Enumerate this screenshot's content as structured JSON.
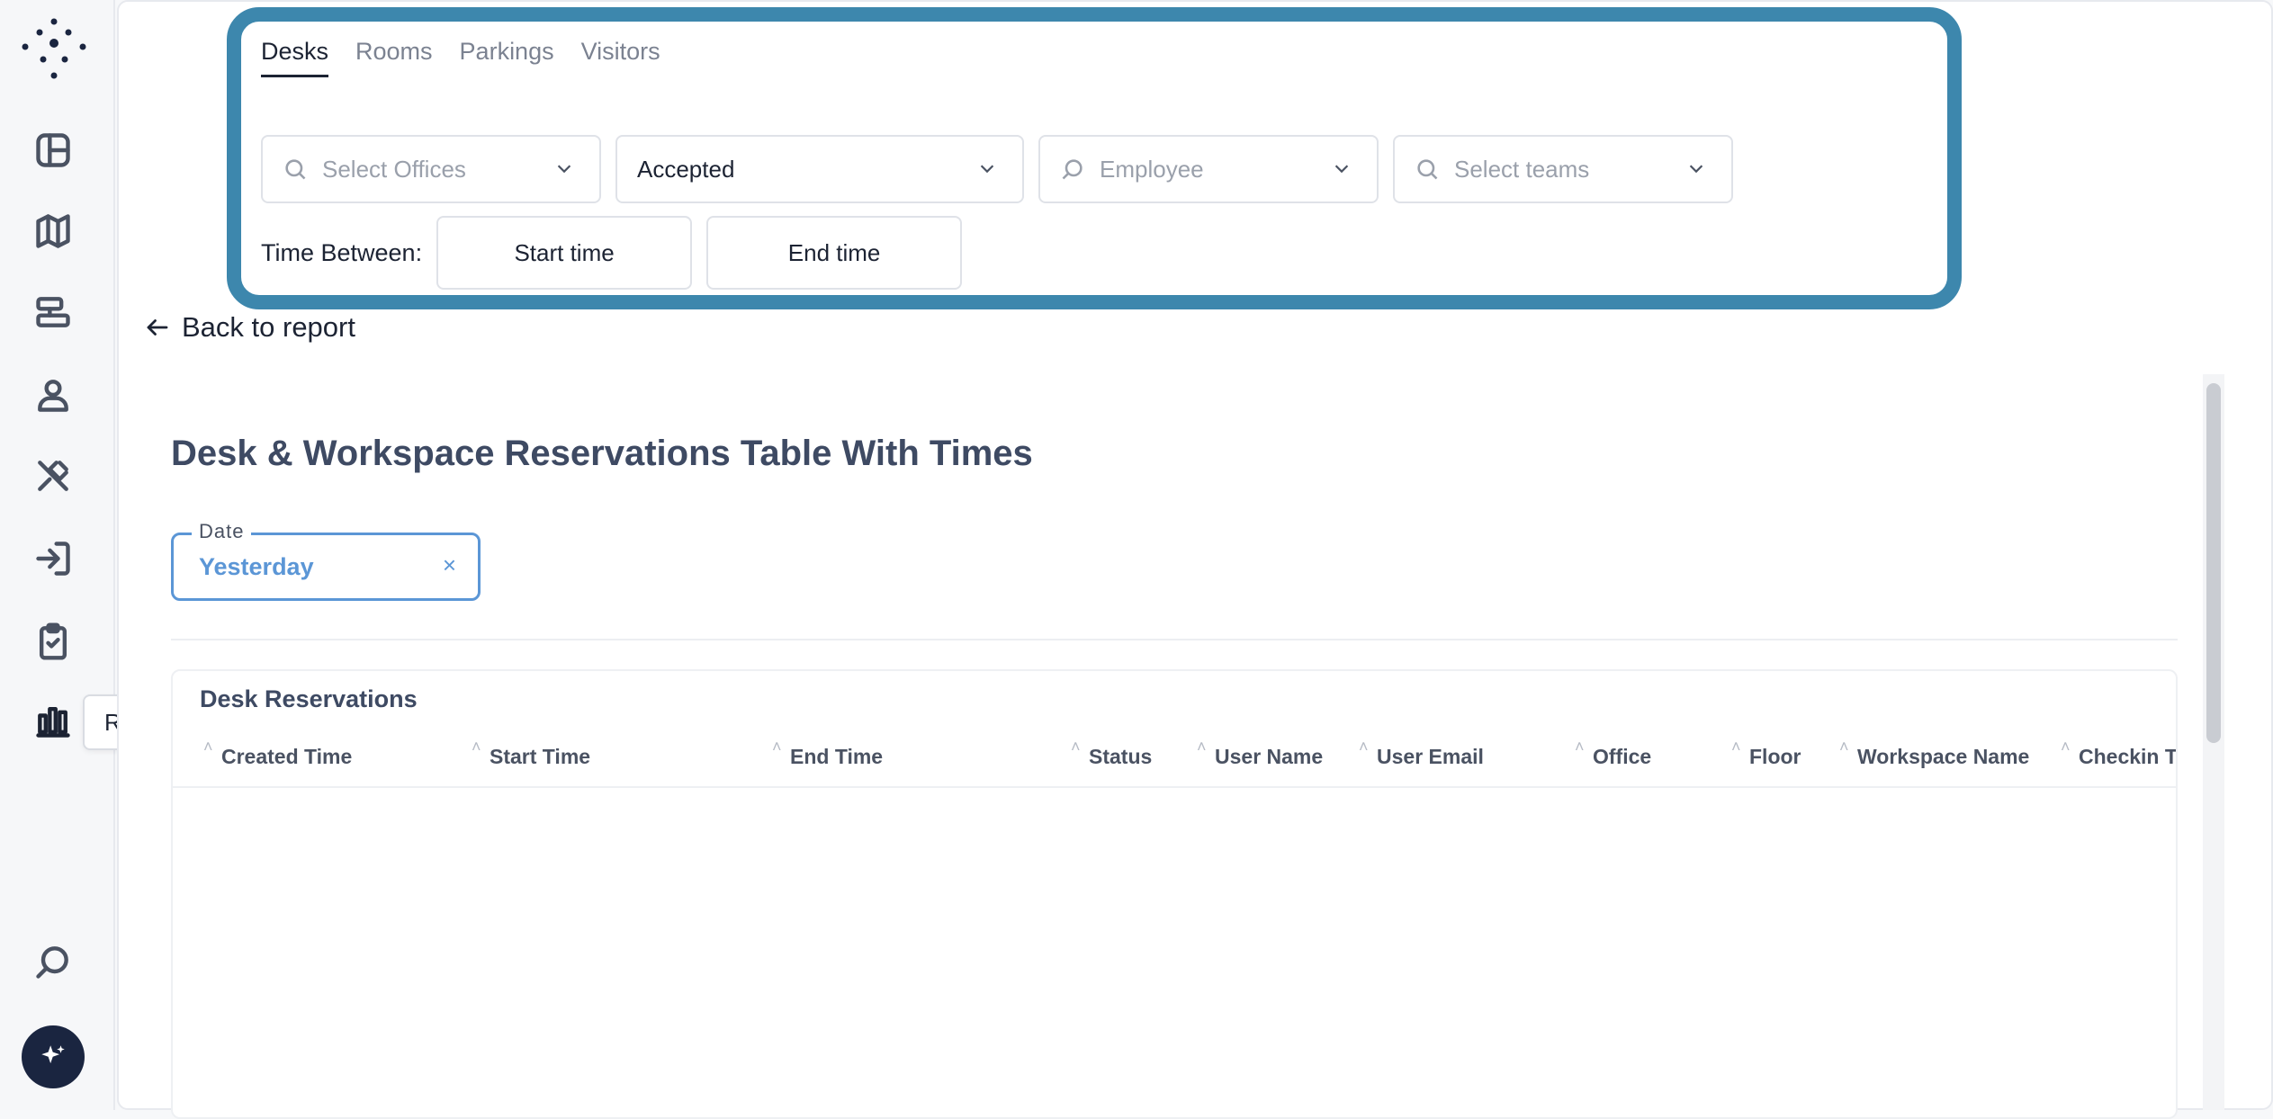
{
  "sidebar": {
    "tooltip": "Reports",
    "icons": [
      "dashboard-icon",
      "map-icon",
      "desk-icon",
      "user-icon",
      "tools-icon",
      "sign-in-icon",
      "clipboard-check-icon",
      "reports-chart-icon",
      "search-icon",
      "ai-sparkle-icon"
    ]
  },
  "filters": {
    "tabs": [
      "Desks",
      "Rooms",
      "Parkings",
      "Visitors"
    ],
    "active_tab": "Desks",
    "offices_placeholder": "Select Offices",
    "status_value": "Accepted",
    "employee_placeholder": "Employee",
    "teams_placeholder": "Select teams",
    "time_between_label": "Time Between:",
    "start_time_label": "Start time",
    "end_time_label": "End time"
  },
  "back_link": "Back to report",
  "report": {
    "title": "Desk & Workspace Reservations Table With Times",
    "date_label": "Date",
    "date_value": "Yesterday",
    "date_clear": "×",
    "table_title": "Desk Reservations",
    "columns": [
      "Created Time",
      "Start Time",
      "End Time",
      "Status",
      "User Name",
      "User Email",
      "Office",
      "Floor",
      "Workspace Name",
      "Checkin Ti"
    ]
  },
  "colors": {
    "highlight_border": "#3d87ad",
    "date_accent": "#5b96d6",
    "ai_button": "#1a2540"
  }
}
